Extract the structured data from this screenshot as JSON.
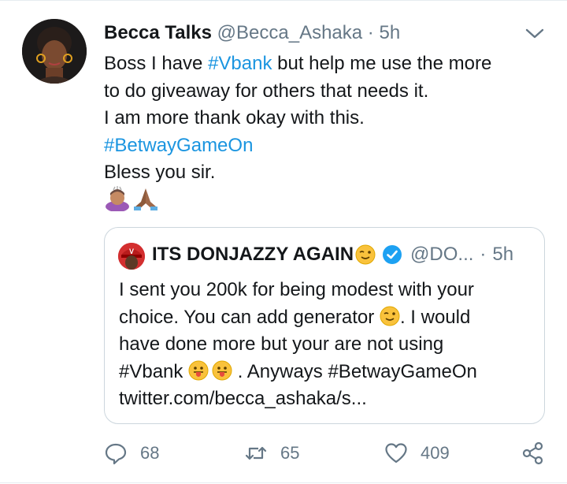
{
  "author": {
    "name": "Becca Talks",
    "handle": "@Becca_Ashaka",
    "separator": "·",
    "time": "5h"
  },
  "tweet": {
    "line1_prefix": "Boss I have ",
    "line1_tag": "#Vbank",
    "line1_suffix": " but help me use the more",
    "line2": "to do giveaway for others that needs it.",
    "line3": "I am more thank okay with this.",
    "line4_tag": "#BetwayGameOn",
    "line5": "Bless you sir.",
    "emojis": [
      "person-bowing-emoji",
      "folded-hands-emoji"
    ]
  },
  "quoted": {
    "name": "ITS DONJAZZY AGAIN",
    "name_emoji": "winking-face-emoji",
    "verified": true,
    "handle": "@DO...",
    "separator": "·",
    "time": "5h",
    "line1": "I sent you 200k for being modest with your",
    "line2_text": "choice. You can add generator ",
    "line2_after": ". I would",
    "line3": "have done more but your are not using",
    "line4_start": "#Vbank ",
    "line4_after": " . Anyways #BetwayGameOn",
    "line5": "twitter.com/becca_ashaka/s..."
  },
  "actions": {
    "reply_count": "68",
    "retweet_count": "65",
    "like_count": "409"
  },
  "colors": {
    "link": "#1b95e0",
    "muted": "#657786",
    "border": "#ccd6dd",
    "verified": "#1da1f2"
  }
}
